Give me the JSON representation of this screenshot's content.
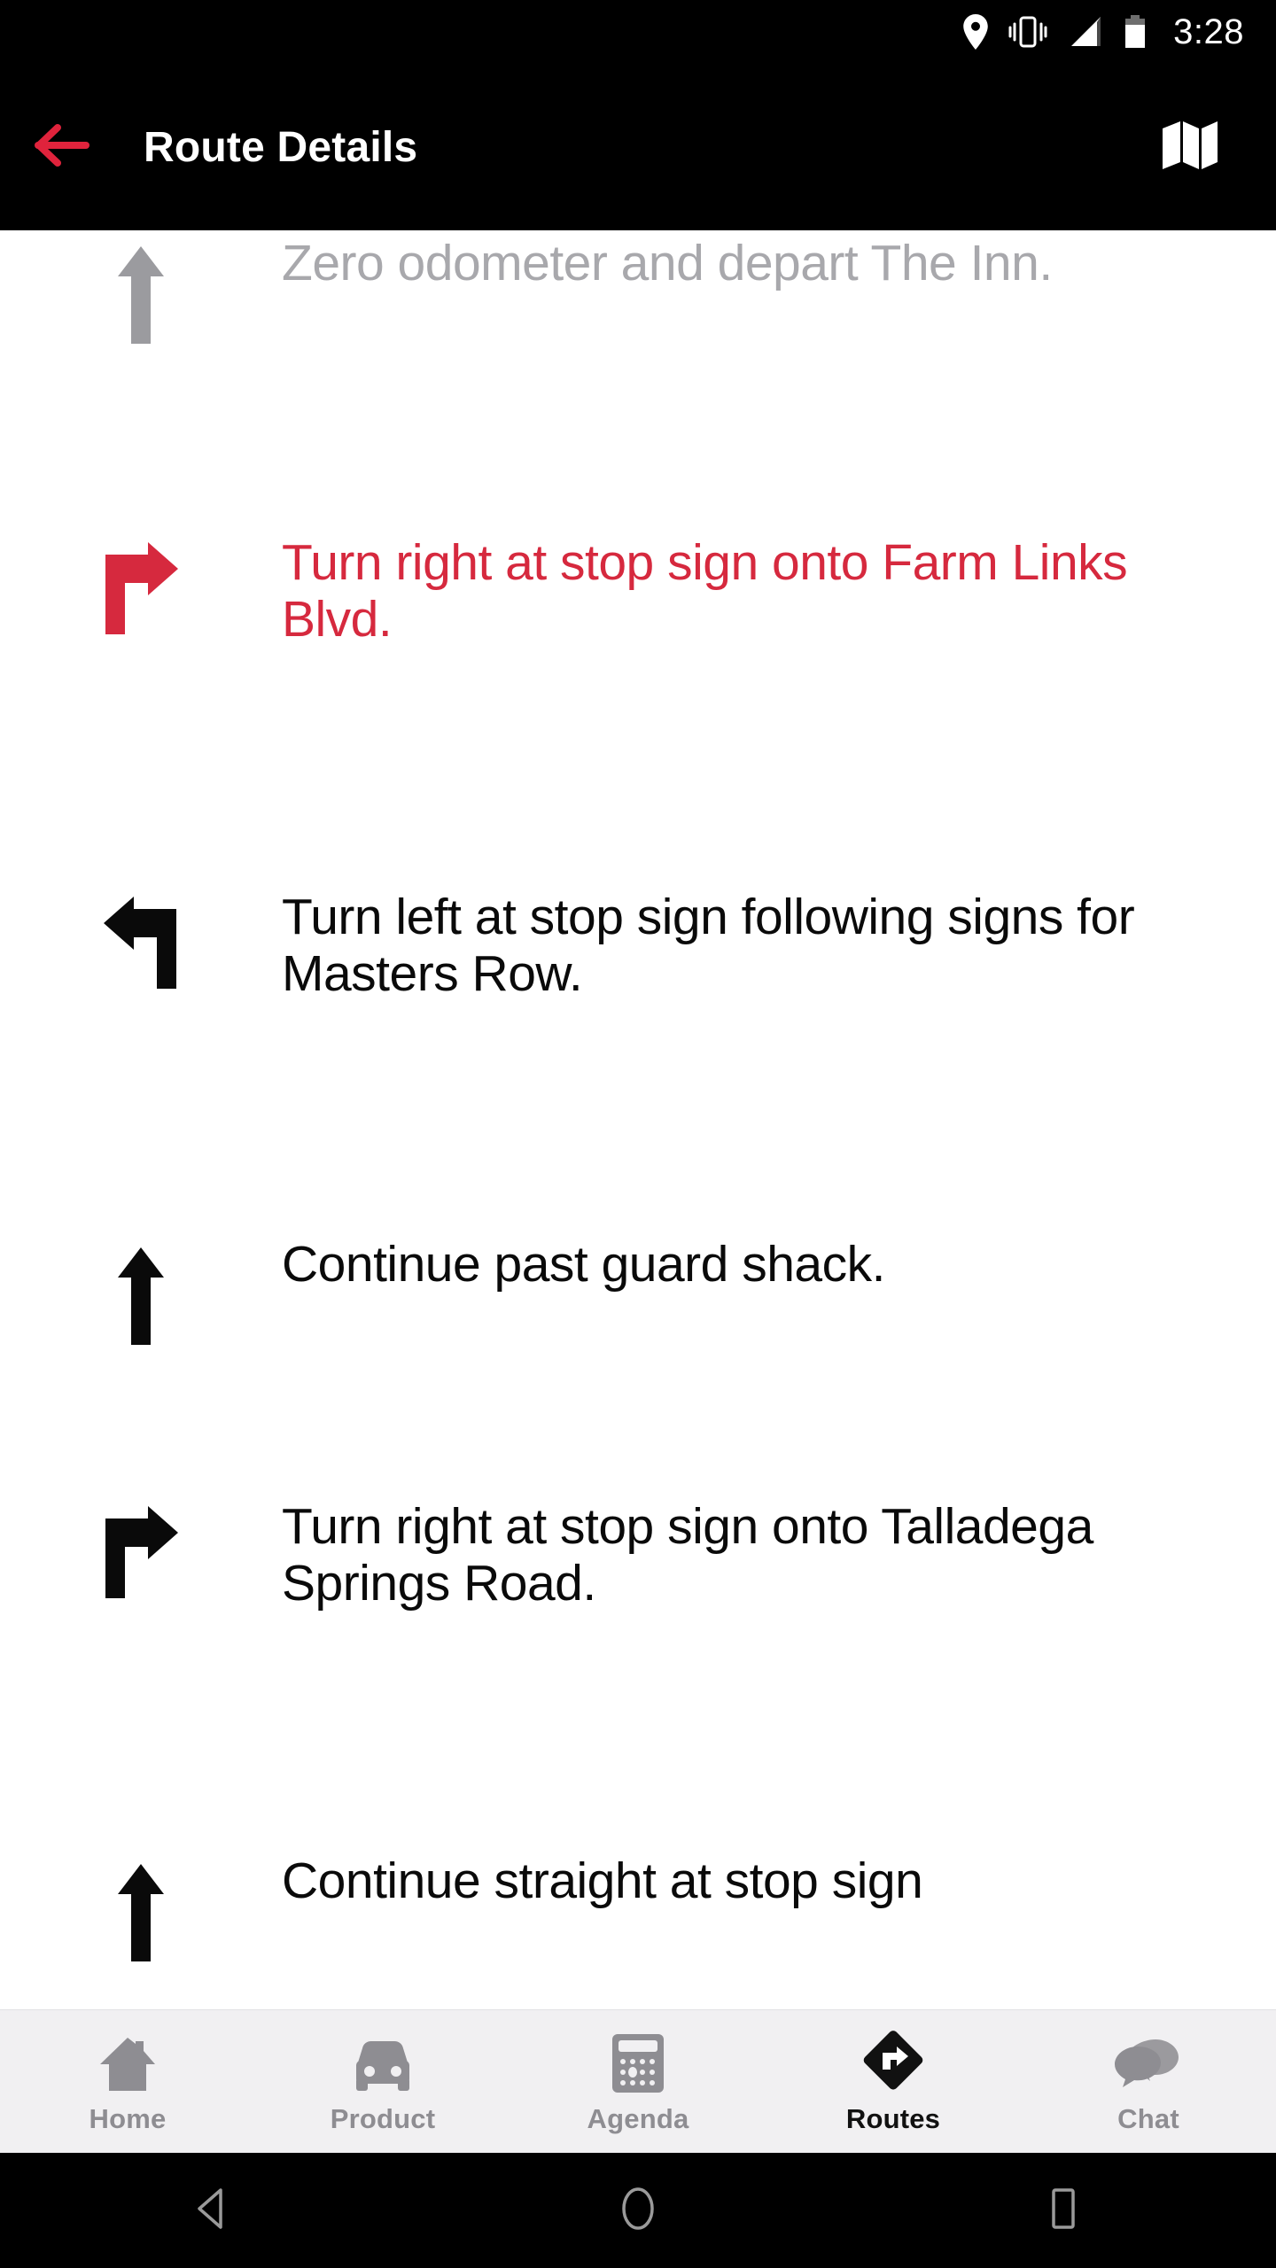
{
  "status_bar": {
    "time": "3:28",
    "icons": [
      "location-pin-icon",
      "vibrate-icon",
      "signal-bars-icon",
      "battery-icon"
    ]
  },
  "app_bar": {
    "title": "Route Details",
    "back_icon": "back-arrow-icon",
    "map_icon": "map-icon",
    "background_color": "#000000",
    "accent_color": "#d6293e"
  },
  "route_steps": [
    {
      "instruction": "Zero odometer and depart The Inn.",
      "maneuver": "straight",
      "state": "pending",
      "color": "#a8a8ac"
    },
    {
      "instruction": "Turn right at stop sign onto Farm Links Blvd.",
      "maneuver": "turn-right",
      "state": "active",
      "color": "#d6293e"
    },
    {
      "instruction": "Turn left at stop sign following signs for Masters Row.",
      "maneuver": "turn-left",
      "state": "done",
      "color": "#0a0a0a"
    },
    {
      "instruction": "Continue past guard shack.",
      "maneuver": "straight",
      "state": "done",
      "color": "#0a0a0a"
    },
    {
      "instruction": "Turn right at stop sign onto Talladega Springs Road.",
      "maneuver": "turn-right",
      "state": "done",
      "color": "#0a0a0a"
    },
    {
      "instruction": "Continue straight at stop sign",
      "maneuver": "straight",
      "state": "done",
      "color": "#0a0a0a"
    }
  ],
  "tab_bar": {
    "background_color": "#f1f0f2",
    "inactive_color": "#8e8d92",
    "active_color": "#111111",
    "items": [
      {
        "label": "Home",
        "icon": "house-icon",
        "active": false
      },
      {
        "label": "Product",
        "icon": "car-icon",
        "active": false
      },
      {
        "label": "Agenda",
        "icon": "calculator-icon",
        "active": false
      },
      {
        "label": "Routes",
        "icon": "route-diamond-icon",
        "active": true
      },
      {
        "label": "Chat",
        "icon": "speech-bubbles-icon",
        "active": false
      }
    ]
  },
  "android_nav": {
    "back": "nav-back-triangle-icon",
    "home": "nav-home-circle-icon",
    "recents": "nav-recents-square-icon"
  }
}
